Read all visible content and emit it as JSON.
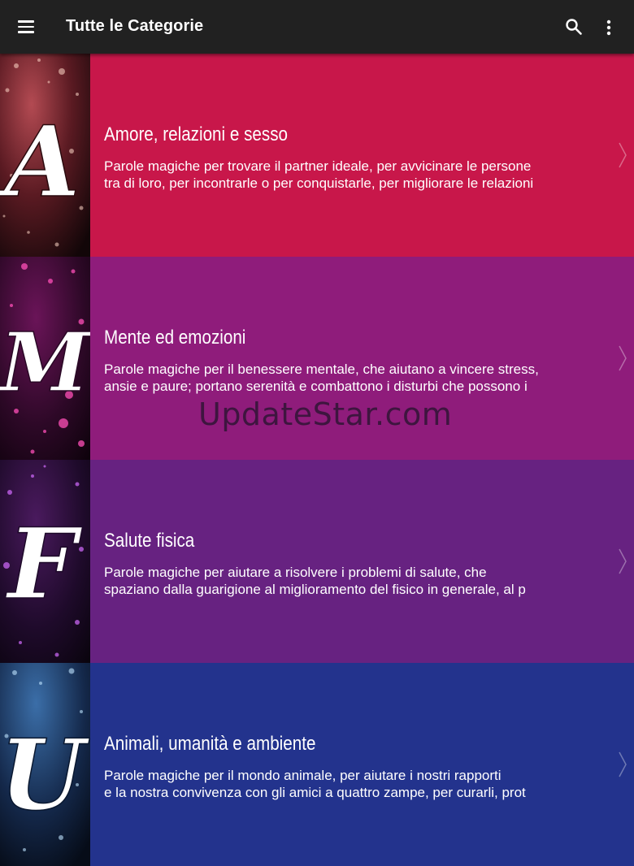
{
  "appbar": {
    "title": "Tutte le Categorie",
    "menu_icon": "hamburger-menu-icon",
    "search_icon": "search-icon",
    "more_icon": "more-vert-icon"
  },
  "categories": [
    {
      "title": "Amore, relazioni e sesso",
      "desc_line1": "Parole magiche per trovare il partner ideale, per avvicinare le persone",
      "desc_line2": "tra di loro, per incontrarle o per conquistarle, per migliorare le relazioni",
      "letter": "A",
      "color": "#c8174a",
      "thumb_color": "#7a1a25"
    },
    {
      "title": "Mente ed emozioni",
      "desc_line1": "Parole magiche per il benessere mentale, che aiutano a vincere stress,",
      "desc_line2": "ansie e paure; portano serenità e combattono i disturbi che possono i",
      "letter": "M",
      "color": "#8f1c7b",
      "thumb_color": "#5a1048"
    },
    {
      "title": "Salute fisica",
      "desc_line1": "Parole magiche per aiutare a risolvere i problemi di salute, che",
      "desc_line2": "spaziano dalla guarigione al miglioramento del fisico in generale, al p",
      "letter": "F",
      "color": "#672281",
      "thumb_color": "#3a1650"
    },
    {
      "title": "Animali, umanità e ambiente",
      "desc_line1": "Parole magiche per il mondo animale, per aiutare i nostri rapporti",
      "desc_line2": "e la nostra convivenza con gli amici a quattro zampe, per curarli, prot",
      "letter": "U",
      "color": "#23338d",
      "thumb_color": "#1c2a5e"
    }
  ],
  "watermark": "UpdateStar.com"
}
